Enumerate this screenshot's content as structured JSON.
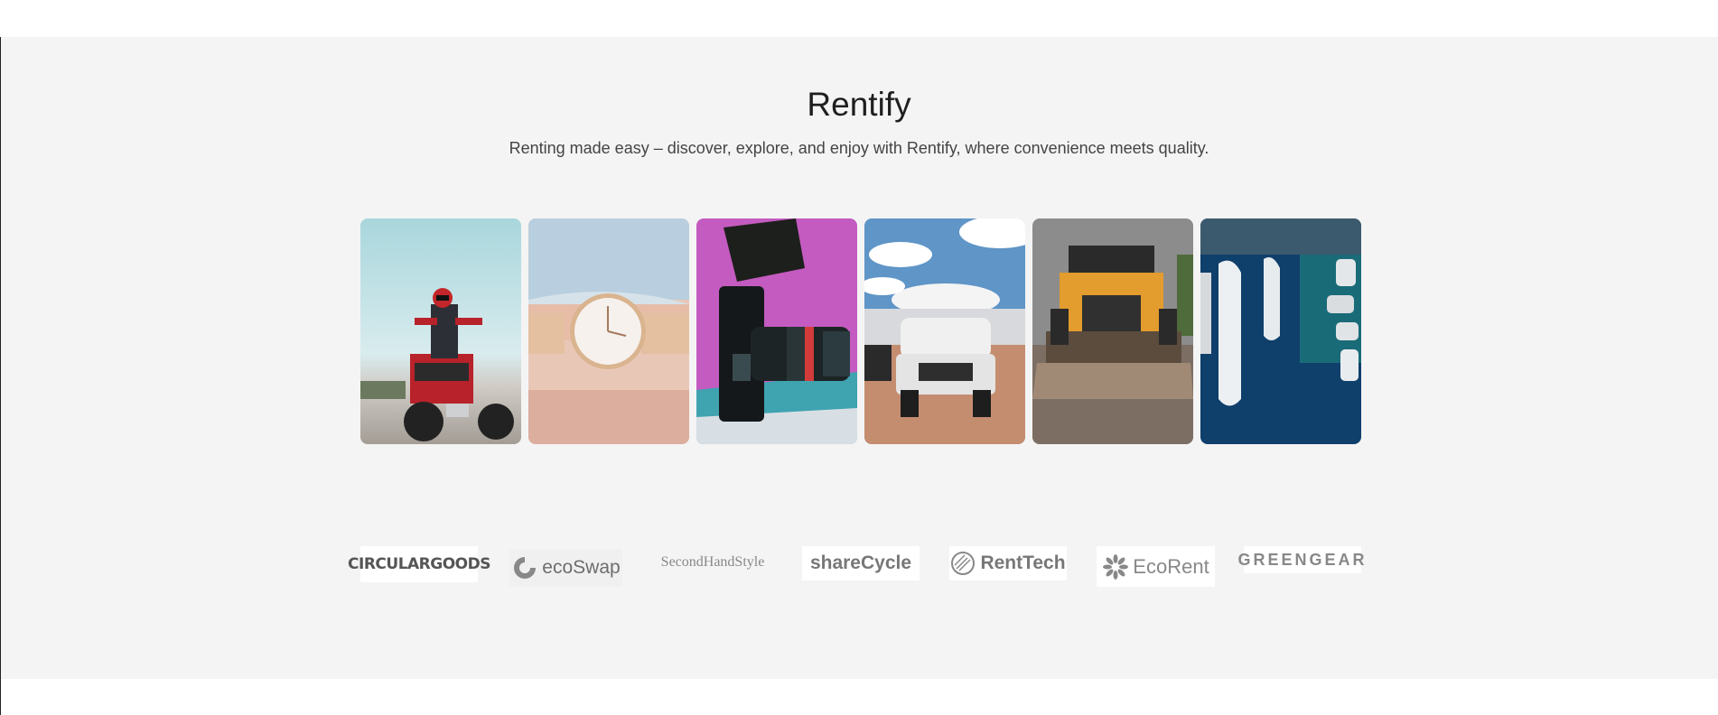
{
  "hero": {
    "title": "Rentify",
    "subtitle": "Renting made easy – discover, explore, and enjoy with Rentify, where convenience meets quality."
  },
  "gallery": {
    "images": [
      {
        "name": "atv-rider-image"
      },
      {
        "name": "wristwatch-image"
      },
      {
        "name": "cinema-camera-image"
      },
      {
        "name": "pickup-truck-image"
      },
      {
        "name": "bulldozer-image"
      },
      {
        "name": "yachts-marina-image"
      }
    ]
  },
  "partners": {
    "logos": [
      {
        "label": "CIRCULARGOODS"
      },
      {
        "label": "ecoSwap"
      },
      {
        "label": "SecondHandStyle"
      },
      {
        "label": "shareCycle"
      },
      {
        "label": "RentTech"
      },
      {
        "label": "EcoRent"
      },
      {
        "label": "GREENGEAR"
      }
    ]
  },
  "colors": {
    "section_bg": "#f4f4f4",
    "title": "#1e1e1e",
    "subtitle": "#444444",
    "logo": "#777777"
  }
}
